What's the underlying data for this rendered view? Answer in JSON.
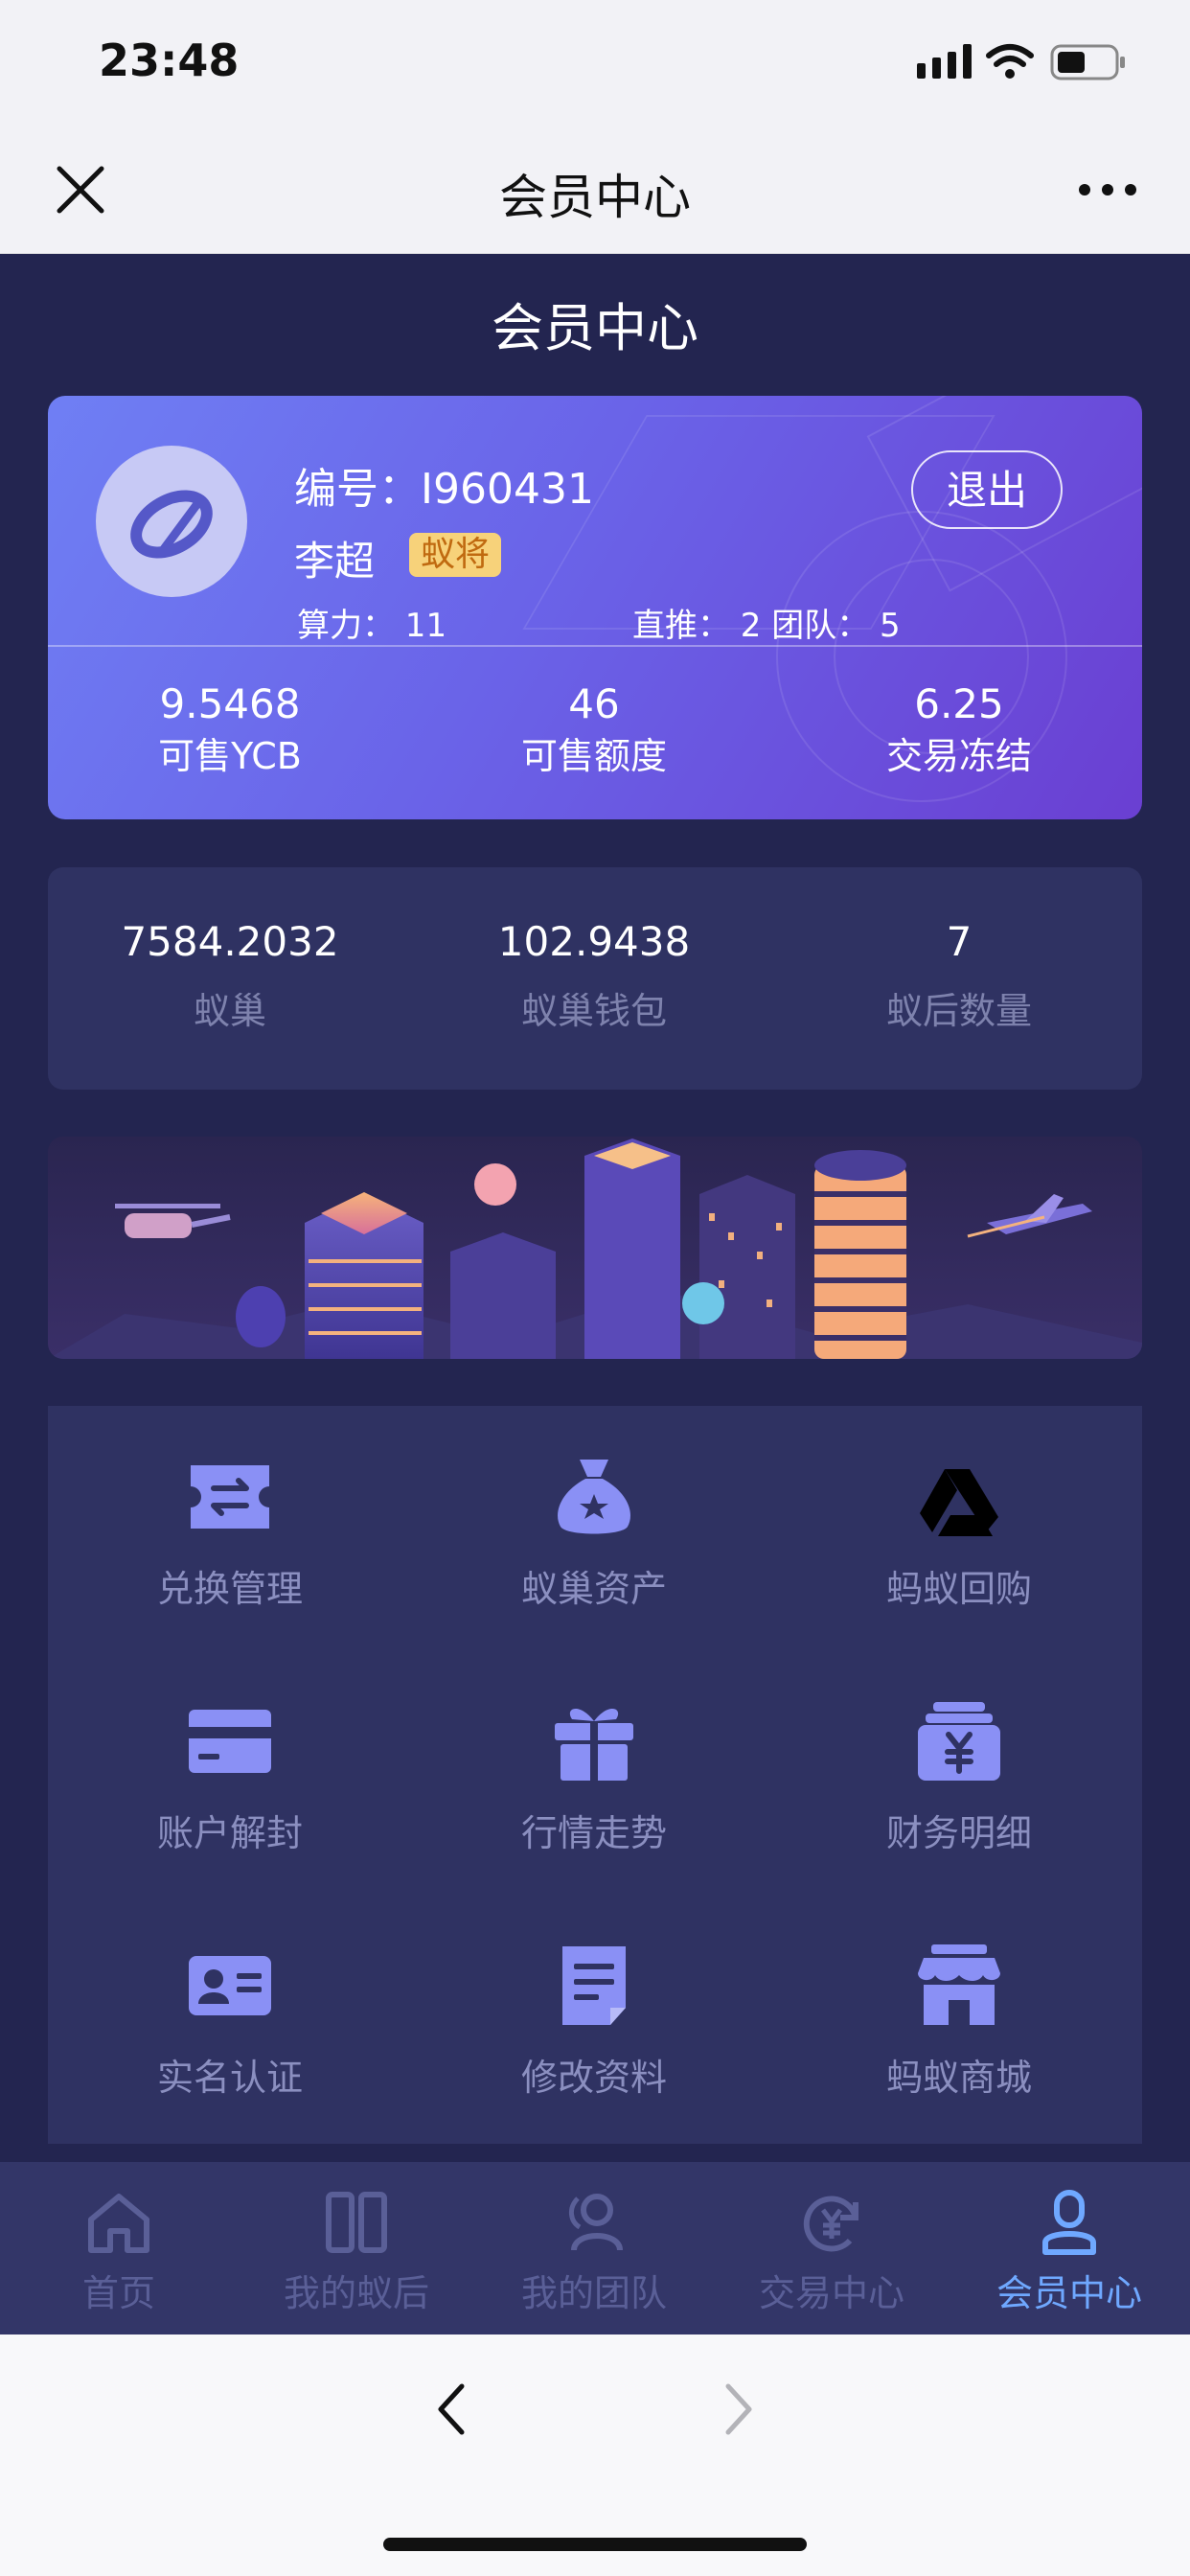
{
  "status_bar": {
    "time": "23:48"
  },
  "nav": {
    "title": "会员中心"
  },
  "page": {
    "title": "会员中心"
  },
  "profile": {
    "id_label": "编号：I960431",
    "name": "李超",
    "level": "蚁将",
    "hashpower": "算力：  11",
    "team": "直推：  2  团队：  5",
    "logout": "退出",
    "stats": [
      {
        "value": "9.5468",
        "label": "可售YCB"
      },
      {
        "value": "46",
        "label": "可售额度"
      },
      {
        "value": "6.25",
        "label": "交易冻结"
      }
    ]
  },
  "assets": [
    {
      "value": "7584.2032",
      "label": "蚁巢"
    },
    {
      "value": "102.9438",
      "label": "蚁巢钱包"
    },
    {
      "value": "7",
      "label": "蚁后数量"
    }
  ],
  "menu": [
    {
      "label": "兑换管理",
      "icon": "exchange-icon"
    },
    {
      "label": "蚁巢资产",
      "icon": "money-bag-icon"
    },
    {
      "label": "蚂蚁回购",
      "icon": "drive-triangle-icon"
    },
    {
      "label": "账户解封",
      "icon": "credit-card-icon"
    },
    {
      "label": "行情走势",
      "icon": "gift-icon"
    },
    {
      "label": "财务明细",
      "icon": "yuan-box-icon"
    },
    {
      "label": "实名认证",
      "icon": "id-card-icon"
    },
    {
      "label": "修改资料",
      "icon": "edit-document-icon"
    },
    {
      "label": "蚂蚁商城",
      "icon": "store-icon"
    }
  ],
  "tabs": [
    {
      "label": "首页",
      "icon": "home-icon",
      "active": false
    },
    {
      "label": "我的蚁后",
      "icon": "columns-icon",
      "active": false
    },
    {
      "label": "我的团队",
      "icon": "team-icon",
      "active": false
    },
    {
      "label": "交易中心",
      "icon": "yuan-cycle-icon",
      "active": false
    },
    {
      "label": "会员中心",
      "icon": "user-icon",
      "active": true
    }
  ],
  "colors": {
    "background": "#232550",
    "panel": "#2f3262",
    "icon": "#8a90f5",
    "active_tab": "#6fa8ff",
    "badge": "#f7d27a"
  }
}
